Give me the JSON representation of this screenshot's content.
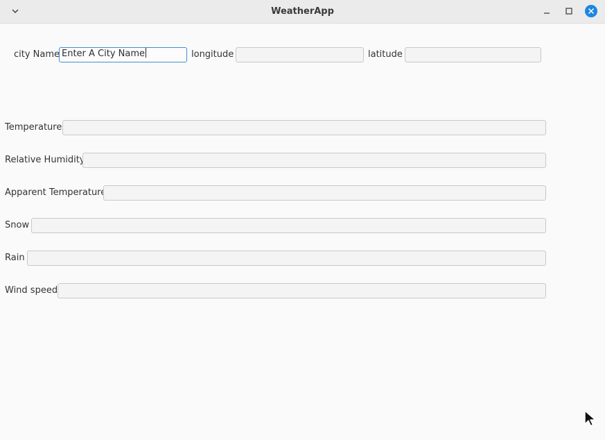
{
  "window": {
    "title": "WeatherApp"
  },
  "location": {
    "city_label": "city Name",
    "city_value": "Enter A City Name",
    "longitude_label": "longitude",
    "longitude_value": "",
    "latitude_label": "latitude",
    "latitude_value": ""
  },
  "results": {
    "temperature_label": "Temperature",
    "temperature_value": "",
    "humidity_label": "Relative Humidity",
    "humidity_value": "",
    "apparent_label": "Apparent Temperature",
    "apparent_value": "",
    "snow_label": "Snow",
    "snow_value": "",
    "rain_label": "Rain",
    "rain_value": "",
    "wind_label": "Wind speed",
    "wind_value": ""
  },
  "colors": {
    "accent": "#1c86e0",
    "focus_border": "#3d8fd6"
  }
}
